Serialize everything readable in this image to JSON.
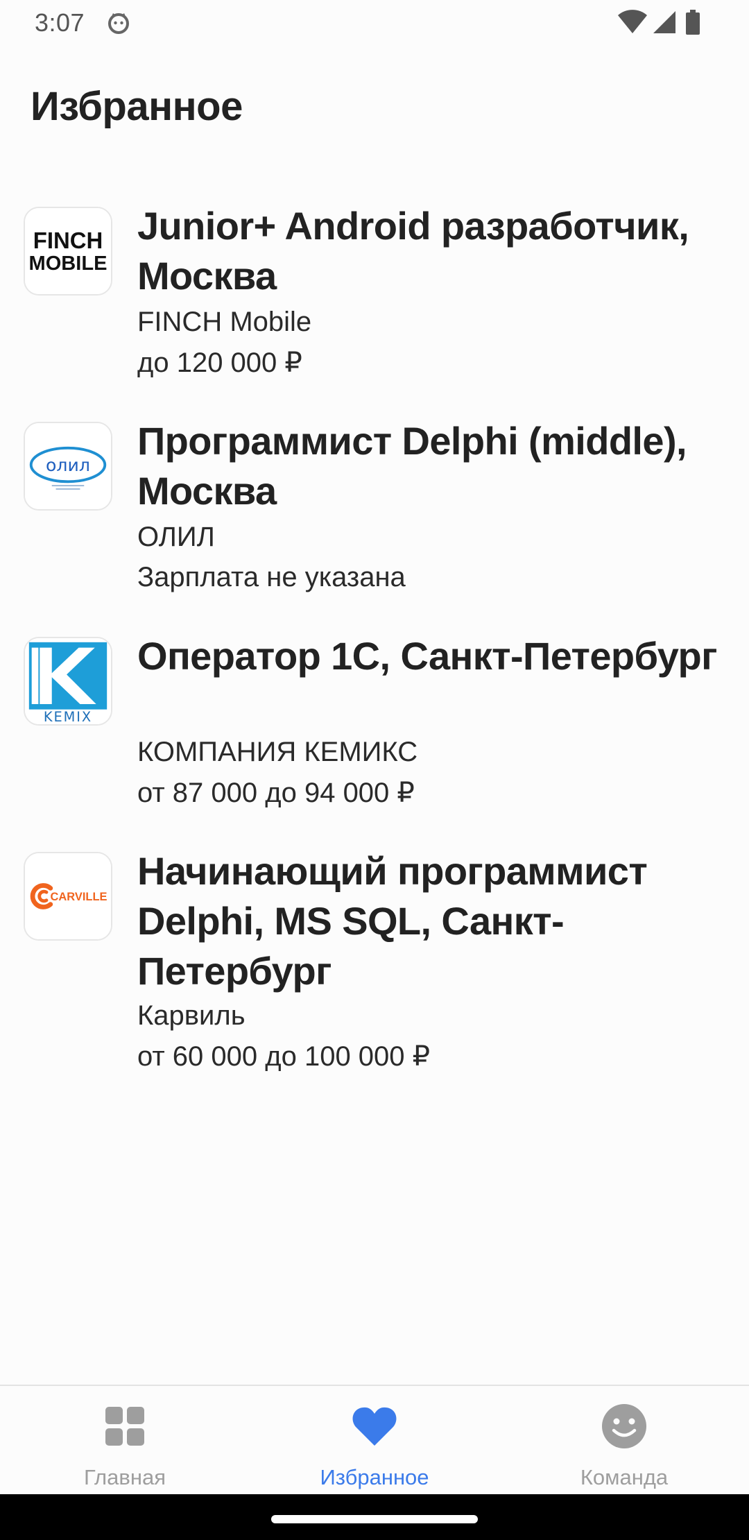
{
  "status_bar": {
    "time": "3:07",
    "icons": [
      "cat-notification-icon",
      "wifi-icon",
      "signal-icon",
      "battery-icon"
    ]
  },
  "page": {
    "title": "Избранное"
  },
  "vacancies": [
    {
      "title": "Junior+ Android разработчик, Москва",
      "company": "FINCH Mobile",
      "salary": "до 120 000 ₽",
      "logo": "finch-mobile-logo",
      "logo_text": [
        "FINCH",
        "MOBILE"
      ]
    },
    {
      "title": "Программист Delphi (middle), Москва",
      "company": "ОЛИЛ",
      "salary": "Зарплата не указана",
      "logo": "olil-logo",
      "logo_text": [
        "олил"
      ]
    },
    {
      "title": "Оператор 1С, Санкт-Петербург",
      "company": "КОМПАНИЯ КЕМИКС",
      "salary": "от 87 000 до 94 000 ₽",
      "logo": "kemix-logo",
      "logo_text": [
        "KEMIX"
      ]
    },
    {
      "title": "Начинающий программист Delphi, MS SQL, Санкт-Петербург",
      "company": "Карвиль",
      "salary": "от 60 000 до 100 000 ₽",
      "logo": "carville-logo",
      "logo_text": [
        "CARVILLE"
      ]
    }
  ],
  "bottom_nav": {
    "items": [
      {
        "label": "Главная",
        "icon": "grid-icon",
        "active": false
      },
      {
        "label": "Избранное",
        "icon": "heart-icon",
        "active": true
      },
      {
        "label": "Команда",
        "icon": "smiley-icon",
        "active": false
      }
    ]
  },
  "colors": {
    "accent": "#3b7bea",
    "inactive": "#9e9e9e",
    "text": "#222222",
    "carville_orange": "#f0641e",
    "kemix_blue": "#1e9ed8"
  }
}
